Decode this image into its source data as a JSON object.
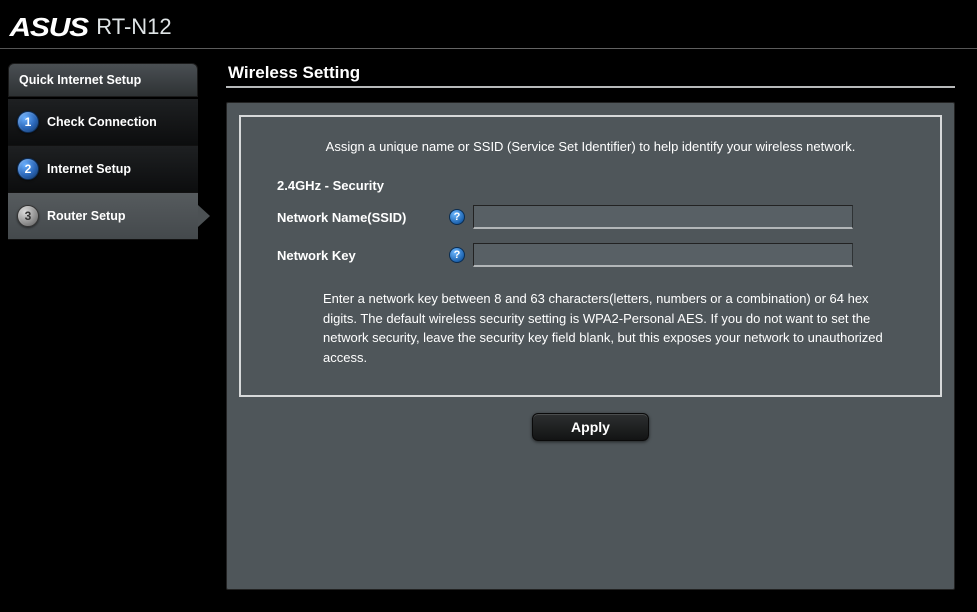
{
  "header": {
    "brand": "ASUS",
    "model": "RT-N12"
  },
  "sidebar": {
    "title": "Quick Internet Setup",
    "steps": [
      {
        "num": "1",
        "label": "Check Connection",
        "active": false
      },
      {
        "num": "2",
        "label": "Internet Setup",
        "active": false
      },
      {
        "num": "3",
        "label": "Router Setup",
        "active": true
      }
    ]
  },
  "main": {
    "title": "Wireless Setting",
    "description": "Assign a unique name or SSID (Service Set Identifier) to help identify your wireless network.",
    "section_title": "2.4GHz - Security",
    "fields": {
      "ssid": {
        "label": "Network Name(SSID)",
        "value": "",
        "help_glyph": "?"
      },
      "key": {
        "label": "Network Key",
        "value": "",
        "help_glyph": "?"
      }
    },
    "help_text": "Enter a network key between 8 and 63 characters(letters, numbers or a combination) or 64 hex digits. The default wireless security setting is WPA2-Personal AES. If you do not want to set the network security, leave the security key field blank, but this exposes your network to unauthorized access.",
    "apply_label": "Apply"
  }
}
